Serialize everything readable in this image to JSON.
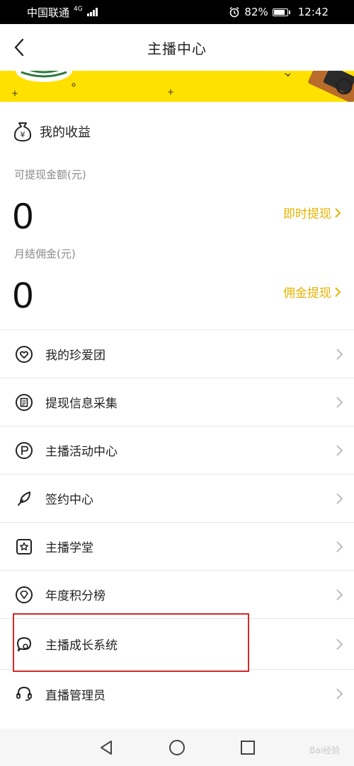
{
  "status_bar": {
    "carrier": "中国联通",
    "network": "4G",
    "battery": "82%",
    "time": "12:42"
  },
  "nav": {
    "title": "主播中心"
  },
  "earnings": {
    "title": "我的收益",
    "withdrawable_label": "可提现金额(元)",
    "withdrawable_value": "0",
    "withdraw_action": "即时提现",
    "commission_label": "月结佣金(元)",
    "commission_value": "0",
    "commission_action": "佣金提现"
  },
  "menu": {
    "items": [
      {
        "label": "我的珍爱团",
        "icon": "heart-circle-icon"
      },
      {
        "label": "提现信息采集",
        "icon": "document-circle-icon"
      },
      {
        "label": "主播活动中心",
        "icon": "flag-circle-icon"
      },
      {
        "label": "签约中心",
        "icon": "feather-icon"
      },
      {
        "label": "主播学堂",
        "icon": "star-square-icon"
      },
      {
        "label": "年度积分榜",
        "icon": "diamond-circle-icon"
      },
      {
        "label": "主播成长系统",
        "icon": "bubble-icon"
      },
      {
        "label": "直播管理员",
        "icon": "headset-icon"
      }
    ]
  },
  "colors": {
    "accent": "#e7b300",
    "banner": "#ffe100",
    "highlight": "#d12a2a"
  },
  "watermark": "Bai经验"
}
